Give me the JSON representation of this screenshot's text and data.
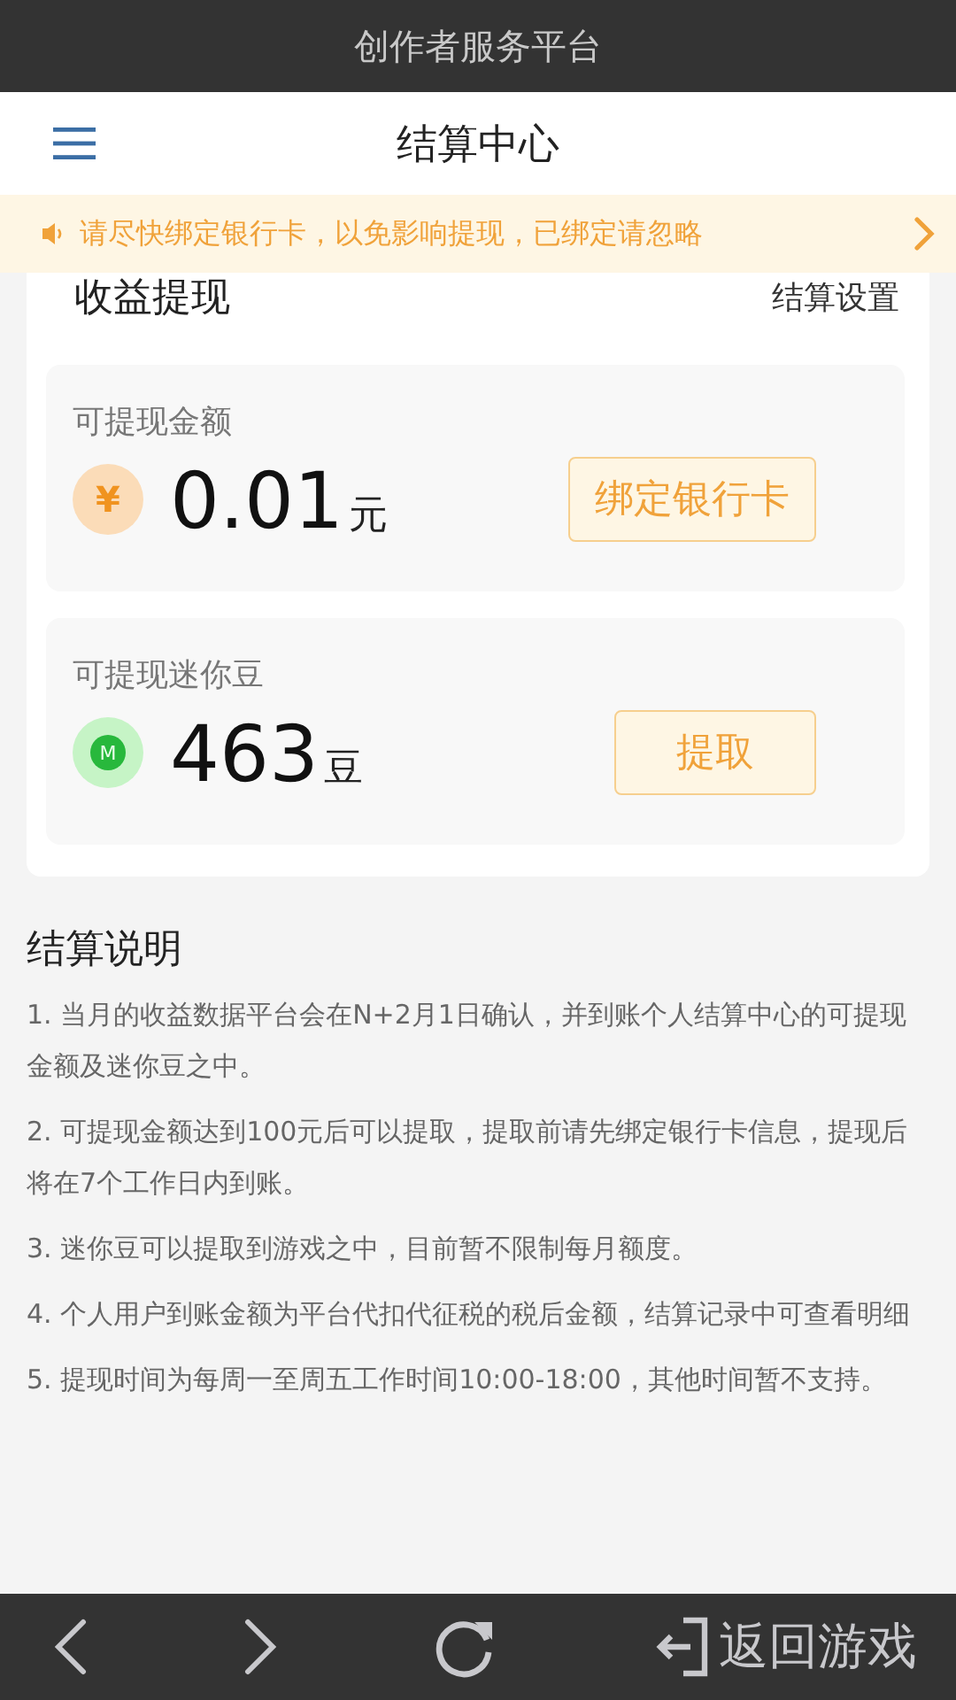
{
  "top_bar": {
    "title": "创作者服务平台"
  },
  "header": {
    "title": "结算中心"
  },
  "notice": {
    "text": "请尽快绑定银行卡，以免影响提现，已绑定请忽略"
  },
  "withdraw": {
    "title": "收益提现",
    "settings_link": "结算设置",
    "accounts": [
      {
        "kind": "yuan",
        "label": "可提现金额",
        "amount": "0.01",
        "unit": "元",
        "button": "绑定银行卡",
        "icon_text": "¥"
      },
      {
        "kind": "bean",
        "label": "可提现迷你豆",
        "amount": "463",
        "unit": "豆",
        "button": "提取",
        "icon_text": "M"
      }
    ]
  },
  "notes": {
    "title": "结算说明",
    "items": [
      "1. 当月的收益数据平台会在N+2月1日确认，并到账个人结算中心的可提现金额及迷你豆之中。",
      "2. 可提现金额达到100元后可以提取，提取前请先绑定银行卡信息，提现后将在7个工作日内到账。",
      "3. 迷你豆可以提取到游戏之中，目前暂不限制每月额度。",
      "4. 个人用户到账金额为平台代扣代征税的税后金额，结算记录中可查看明细",
      "5. 提现时间为每周一至周五工作时间10:00-18:00，其他时间暂不支持。"
    ]
  },
  "bottom_bar": {
    "return_label": "返回游戏"
  }
}
